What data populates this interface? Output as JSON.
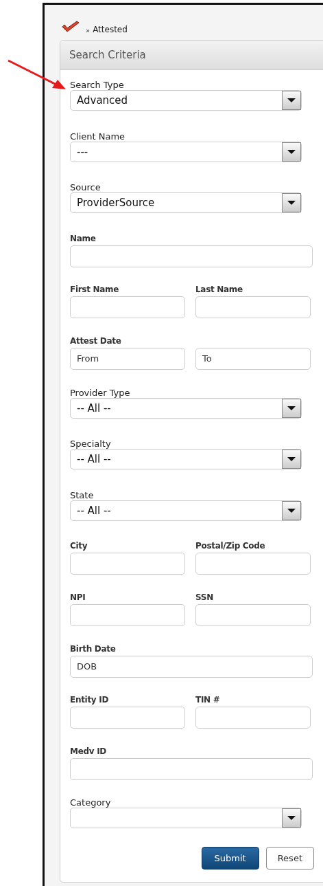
{
  "breadcrumb": {
    "separator": "»",
    "label": "Attested"
  },
  "panel": {
    "title": "Search Criteria"
  },
  "fields": [
    {
      "kind": "select",
      "label": "Search Type",
      "value": "Advanced"
    },
    {
      "kind": "select",
      "label": "Client Name",
      "value": "---"
    },
    {
      "kind": "select",
      "label": "Source",
      "value": "ProviderSource"
    },
    {
      "kind": "text",
      "label": "Name"
    },
    {
      "kind": "pair",
      "items": [
        {
          "label": "First Name"
        },
        {
          "label": "Last Name"
        }
      ]
    },
    {
      "kind": "pair",
      "label": "Attest Date",
      "items": [
        {
          "placeholder": "From"
        },
        {
          "placeholder": "To"
        }
      ]
    },
    {
      "kind": "select",
      "label": "Provider Type",
      "value": "-- All --"
    },
    {
      "kind": "select",
      "label": "Specialty",
      "value": "-- All --"
    },
    {
      "kind": "select",
      "label": "State",
      "value": "-- All --"
    },
    {
      "kind": "pair",
      "items": [
        {
          "label": "City"
        },
        {
          "label": "Postal/Zip Code"
        }
      ]
    },
    {
      "kind": "pair",
      "items": [
        {
          "label": "NPI"
        },
        {
          "label": "SSN"
        }
      ]
    },
    {
      "kind": "text",
      "label": "Birth Date",
      "placeholder": "DOB"
    },
    {
      "kind": "pair",
      "items": [
        {
          "label": "Entity ID"
        },
        {
          "label": "TIN #"
        }
      ]
    },
    {
      "kind": "text",
      "label": "Medv ID"
    },
    {
      "kind": "select",
      "label": "Category"
    }
  ],
  "buttons": [
    {
      "label": "Submit",
      "primary": true
    },
    {
      "label": "Reset",
      "primary": false
    }
  ]
}
